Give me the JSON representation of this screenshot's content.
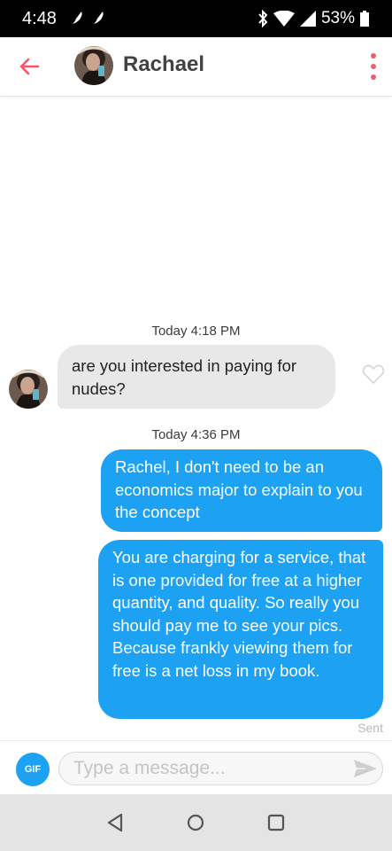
{
  "status_bar": {
    "time": "4:48",
    "battery": "53%",
    "icons": [
      "feather-icon",
      "feather-icon",
      "bluetooth-icon",
      "wifi-icon",
      "signal-icon",
      "battery-icon"
    ]
  },
  "header": {
    "contact_name": "Rachael",
    "back_icon": "arrow-left-icon",
    "menu_icon": "more-vertical-icon"
  },
  "conversation": {
    "timestamp_1": "Today 4:18 PM",
    "received_message": "are you interested in paying for nudes?",
    "timestamp_2": "Today 4:36 PM",
    "sent_message_1": "Rachel, I don't need to be an economics major to explain to you the concept",
    "sent_message_2": "You are charging for a service, that is one provided for free at a higher quantity, and quality. So really you should pay me to see your pics. Because frankly viewing them for free is a net loss in my book.",
    "sent_status": "Sent"
  },
  "composer": {
    "gif_label": "GIF",
    "placeholder": "Type a message..."
  },
  "nav_bar": {
    "buttons": [
      "back-triangle-icon",
      "home-circle-icon",
      "recents-square-icon"
    ]
  },
  "colors": {
    "accent_blue": "#1da1f2",
    "received_bubble": "#e8e8e8",
    "back_arrow": "#fd5564",
    "menu_dots": "#e8616a"
  }
}
